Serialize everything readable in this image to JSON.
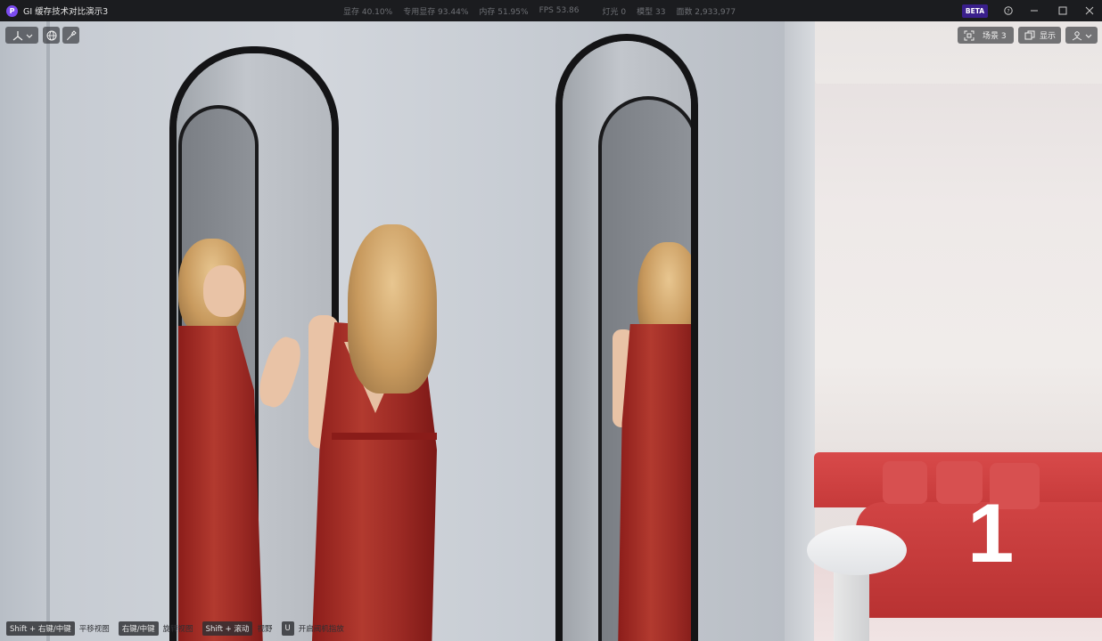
{
  "window": {
    "logo_letter": "P",
    "title": "GI 缓存技术对比演示3",
    "stats": [
      "显存 40.10%",
      "专用显存 93.44%",
      "内存 51.95%",
      "FPS 53.86",
      "灯光 0",
      "模型 33",
      "面数 2,933,977"
    ],
    "beta_badge": "BETA"
  },
  "toolbar": {
    "scene_label": "场景 3",
    "display_label": "显示"
  },
  "scene": {
    "overlay_number": "1"
  },
  "hints": [
    {
      "key": "Shift + 右键/中键",
      "label": "平移视图"
    },
    {
      "key": "右键/中键",
      "label": "旋转视图"
    },
    {
      "key": "Shift + 滚动",
      "label": "视野"
    },
    {
      "key": "U",
      "label": "开启阀机指放"
    }
  ]
}
